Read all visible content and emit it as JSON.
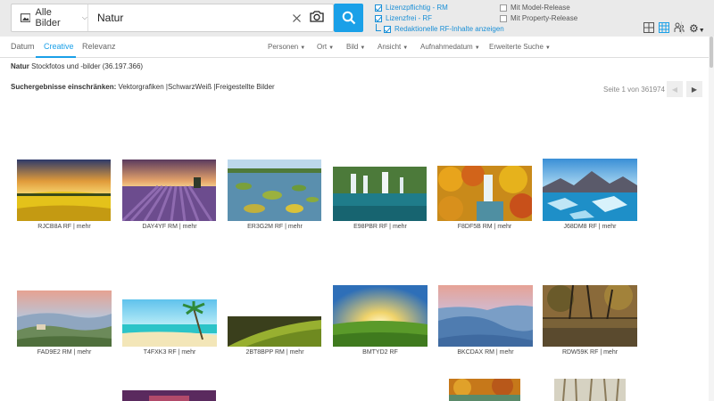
{
  "search": {
    "scope_label": "Alle Bilder",
    "query": "Natur"
  },
  "licenses": {
    "rm": "Lizenzpflichtig - RM",
    "rf": "Lizenzfrei - RF",
    "editorial": "Redaktionelle RF-Inhalte anzeigen",
    "model": "Mit Model-Release",
    "property": "Mit Property-Release"
  },
  "tabs": [
    "Datum",
    "Creative",
    "Relevanz"
  ],
  "filters": [
    "Personen",
    "Ort",
    "Bild",
    "Ansicht",
    "Aufnahmedatum",
    "Erweiterte Suche"
  ],
  "results": {
    "query_bold": "Natur",
    "summary": "Stockfotos und -bilder (36.197.366)"
  },
  "refine": {
    "label": "Suchergebnisse einschränken:",
    "links": [
      "Vektorgrafiken",
      "SchwarzWeiß",
      "Freigestellte Bilder"
    ]
  },
  "pagination": {
    "text": "Seite 1 von 361974"
  },
  "thumbnails": [
    {
      "caption": "RJCB8A RF | mehr"
    },
    {
      "caption": "DAY4YF RM | mehr"
    },
    {
      "caption": "ER3G2M RF | mehr"
    },
    {
      "caption": "E98PBR RF | mehr"
    },
    {
      "caption": "F8DF5B RM | mehr"
    },
    {
      "caption": "J68DM8 RF | mehr"
    },
    {
      "caption": "FAD9E2 RM | mehr"
    },
    {
      "caption": "T4FXK3 RF | mehr"
    },
    {
      "caption": "2BT8BPP RM | mehr"
    },
    {
      "caption": "BMTYD2 RF"
    },
    {
      "caption": "BKCDAX RM | mehr"
    },
    {
      "caption": "RDW59K RF | mehr"
    }
  ],
  "colors": {
    "accent": "#1aa0e8",
    "link": "#1a8fd6",
    "topbar": "#eaeaea"
  }
}
